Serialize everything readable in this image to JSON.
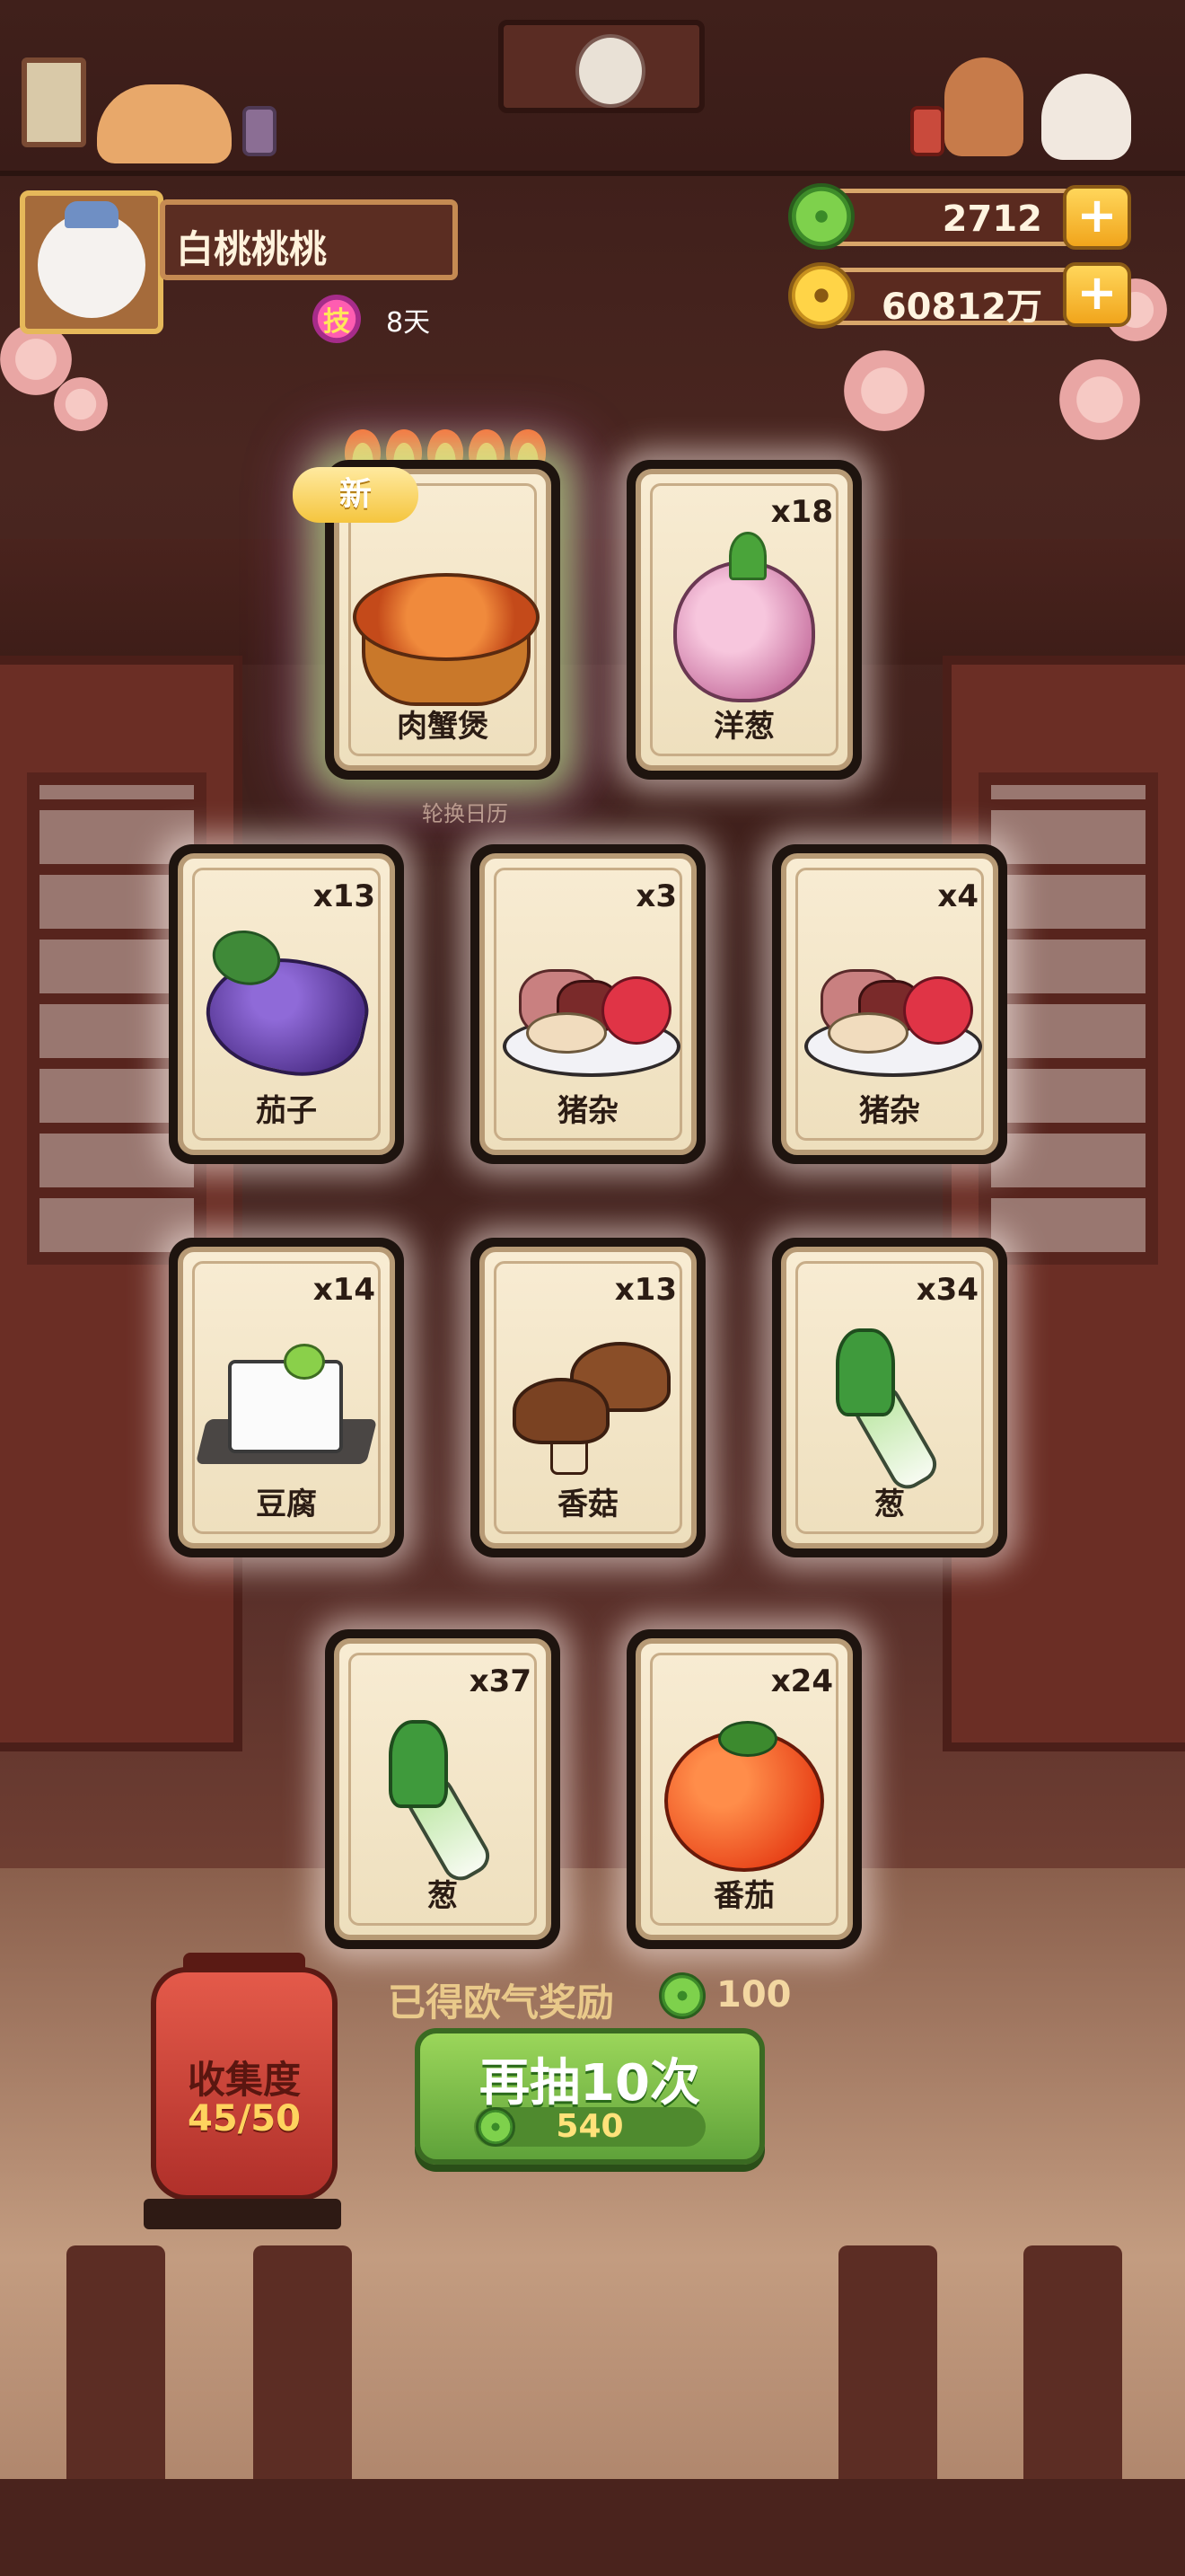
{
  "player": {
    "name": "白桃桃桃",
    "skill_icon_label": "技",
    "skill_days": "8天"
  },
  "currency": {
    "jade": {
      "icon": "jade-icon",
      "value": "2712"
    },
    "coins": {
      "icon": "coin-icon",
      "value": "60812万"
    },
    "plus_label": "+"
  },
  "draw_results": {
    "featured": {
      "name": "肉蟹煲",
      "badge": "新",
      "flames": 5,
      "sublabel": "轮换日历",
      "icon": "crab-stew-icon"
    },
    "cards": [
      {
        "name": "洋葱",
        "count": "x18",
        "icon": "onion-icon"
      },
      {
        "name": "茄子",
        "count": "x13",
        "icon": "eggplant-icon"
      },
      {
        "name": "猪杂",
        "count": "x3",
        "icon": "pork-offal-icon"
      },
      {
        "name": "猪杂",
        "count": "x4",
        "icon": "pork-offal-icon"
      },
      {
        "name": "豆腐",
        "count": "x14",
        "icon": "tofu-icon"
      },
      {
        "name": "香菇",
        "count": "x13",
        "icon": "shiitake-icon"
      },
      {
        "name": "葱",
        "count": "x34",
        "icon": "scallion-icon"
      },
      {
        "name": "葱",
        "count": "x37",
        "icon": "scallion-icon"
      },
      {
        "name": "番茄",
        "count": "x24",
        "icon": "tomato-icon"
      }
    ]
  },
  "reward": {
    "label": "已得欧气奖励",
    "value": "100"
  },
  "collection": {
    "label": "收集度",
    "progress": "45/50"
  },
  "draw_again": {
    "label": "再抽10次",
    "cost": "540"
  }
}
